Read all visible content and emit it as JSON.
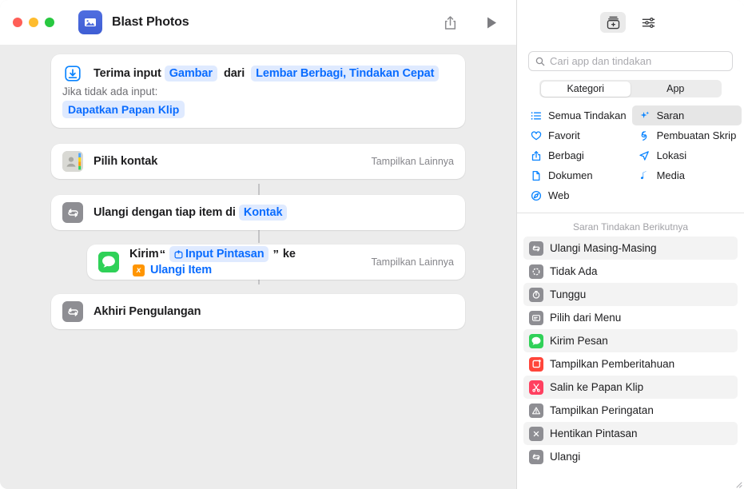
{
  "window": {
    "traffic_lights": [
      "close",
      "minimize",
      "zoom"
    ],
    "app_icon": "photos-icon",
    "title": "Blast Photos",
    "toolbar": {
      "share_label": "share-icon",
      "run_label": "play-icon"
    }
  },
  "editor": {
    "actions": [
      {
        "id": "receive-input",
        "icon": "receive-input-icon",
        "prefix": "Terima input",
        "token1": "Gambar",
        "mid": "dari",
        "token2": "Lembar Berbagi, Tindakan Cepat",
        "sub_label": "Jika tidak ada input:",
        "sub_token": "Dapatkan Papan Klip"
      },
      {
        "id": "select-contact",
        "icon": "contacts-icon",
        "label": "Pilih kontak",
        "show_more": "Tampilkan Lainnya"
      },
      {
        "id": "repeat-each",
        "icon": "repeat-icon",
        "prefix": "Ulangi dengan tiap item di",
        "token1": "Kontak"
      },
      {
        "id": "send-message",
        "icon": "messages-icon",
        "prefix": "Kirim",
        "quote_open": "“",
        "token1": "Input Pintasan",
        "token1_icon": "shortcut-input-icon",
        "quote_close": "”",
        "mid": "ke",
        "token2": "Ulangi Item",
        "token2_badge": "x",
        "show_more": "Tampilkan Lainnya"
      },
      {
        "id": "end-repeat",
        "icon": "repeat-icon",
        "label": "Akhiri Pengulangan"
      }
    ]
  },
  "sidebar": {
    "toolbar": {
      "library_label": "action-library-icon",
      "settings_label": "sliders-icon"
    },
    "search": {
      "placeholder": "Cari app dan tindakan",
      "value": "",
      "icon": "search-icon"
    },
    "segmented": {
      "options": [
        "Kategori",
        "App"
      ],
      "selected": "Kategori"
    },
    "categories": [
      {
        "label": "Semua Tindakan",
        "icon": "list-icon",
        "selected": false
      },
      {
        "label": "Saran",
        "icon": "sparkles-icon",
        "selected": true
      },
      {
        "label": "Favorit",
        "icon": "heart-icon",
        "selected": false
      },
      {
        "label": "Pembuatan Skrip",
        "icon": "scripting-icon",
        "selected": false
      },
      {
        "label": "Berbagi",
        "icon": "share-icon",
        "selected": false
      },
      {
        "label": "Lokasi",
        "icon": "location-icon",
        "selected": false
      },
      {
        "label": "Dokumen",
        "icon": "document-icon",
        "selected": false
      },
      {
        "label": "Media",
        "icon": "music-note-icon",
        "selected": false
      },
      {
        "label": "Web",
        "icon": "compass-icon",
        "selected": false
      }
    ],
    "suggestions_header": "Saran Tindakan Berikutnya",
    "suggestions": [
      {
        "label": "Ulangi Masing-Masing",
        "icon": "repeat-icon",
        "color": "gray"
      },
      {
        "label": "Tidak Ada",
        "icon": "nothing-icon",
        "color": "gray"
      },
      {
        "label": "Tunggu",
        "icon": "wait-icon",
        "color": "gray"
      },
      {
        "label": "Pilih dari Menu",
        "icon": "menu-icon",
        "color": "gray"
      },
      {
        "label": "Kirim Pesan",
        "icon": "messages-icon",
        "color": "green"
      },
      {
        "label": "Tampilkan Pemberitahuan",
        "icon": "notification-icon",
        "color": "red"
      },
      {
        "label": "Salin ke Papan Klip",
        "icon": "clipboard-icon",
        "color": "pink"
      },
      {
        "label": "Tampilkan Peringatan",
        "icon": "alert-icon",
        "color": "gray"
      },
      {
        "label": "Hentikan Pintasan",
        "icon": "stop-icon",
        "color": "gray"
      },
      {
        "label": "Ulangi",
        "icon": "repeat-icon",
        "color": "gray"
      }
    ]
  },
  "colors": {
    "accent_blue": "#0a84ff",
    "token_blue_bg": "#dfeaff",
    "token_blue_text": "#0a6cff",
    "variable_orange": "#ff9500",
    "messages_green": "#30d158",
    "gray_icon": "#8e8e93",
    "canvas_bg": "#ececec"
  }
}
